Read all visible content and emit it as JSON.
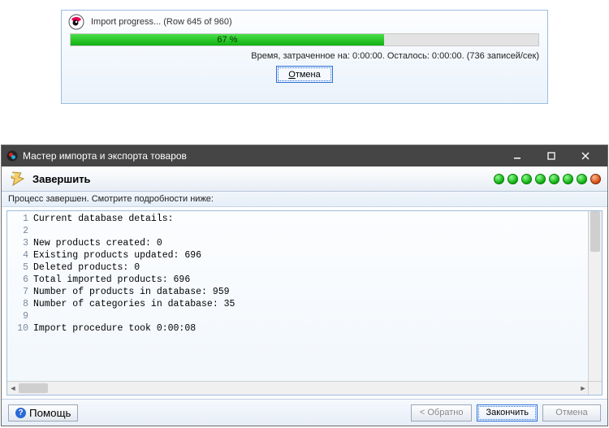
{
  "popup": {
    "title": "Import progress... (Row 645 of 960)",
    "progress_percent": 67,
    "progress_label": "67 %",
    "time_line": "Время, затраченное на: 0:00:00. Осталось: 0:00:00. (736 записей/сек)",
    "cancel_label_u": "О",
    "cancel_label_rest": "тмена"
  },
  "win": {
    "title": "Мастер импорта и экспорта товаров",
    "subhead": "Завершить",
    "caption": "Процесс завершен. Смотрите подробности ниже:",
    "log_lines": [
      {
        "n": 1,
        "t": "Current database details:"
      },
      {
        "n": 2,
        "t": ""
      },
      {
        "n": 3,
        "t": "New products created: 0"
      },
      {
        "n": 4,
        "t": "Existing products updated: 696"
      },
      {
        "n": 5,
        "t": "Deleted products: 0"
      },
      {
        "n": 6,
        "t": "Total imported products: 696"
      },
      {
        "n": 7,
        "t": "Number of products in database: 959"
      },
      {
        "n": 8,
        "t": "Number of categories in database: 35"
      },
      {
        "n": 9,
        "t": ""
      },
      {
        "n": 10,
        "t": "Import procedure took 0:00:08"
      }
    ],
    "footer": {
      "help": "Помощь",
      "back": "< Обратно",
      "finish": "Закончить",
      "cancel": "Отмена"
    }
  }
}
